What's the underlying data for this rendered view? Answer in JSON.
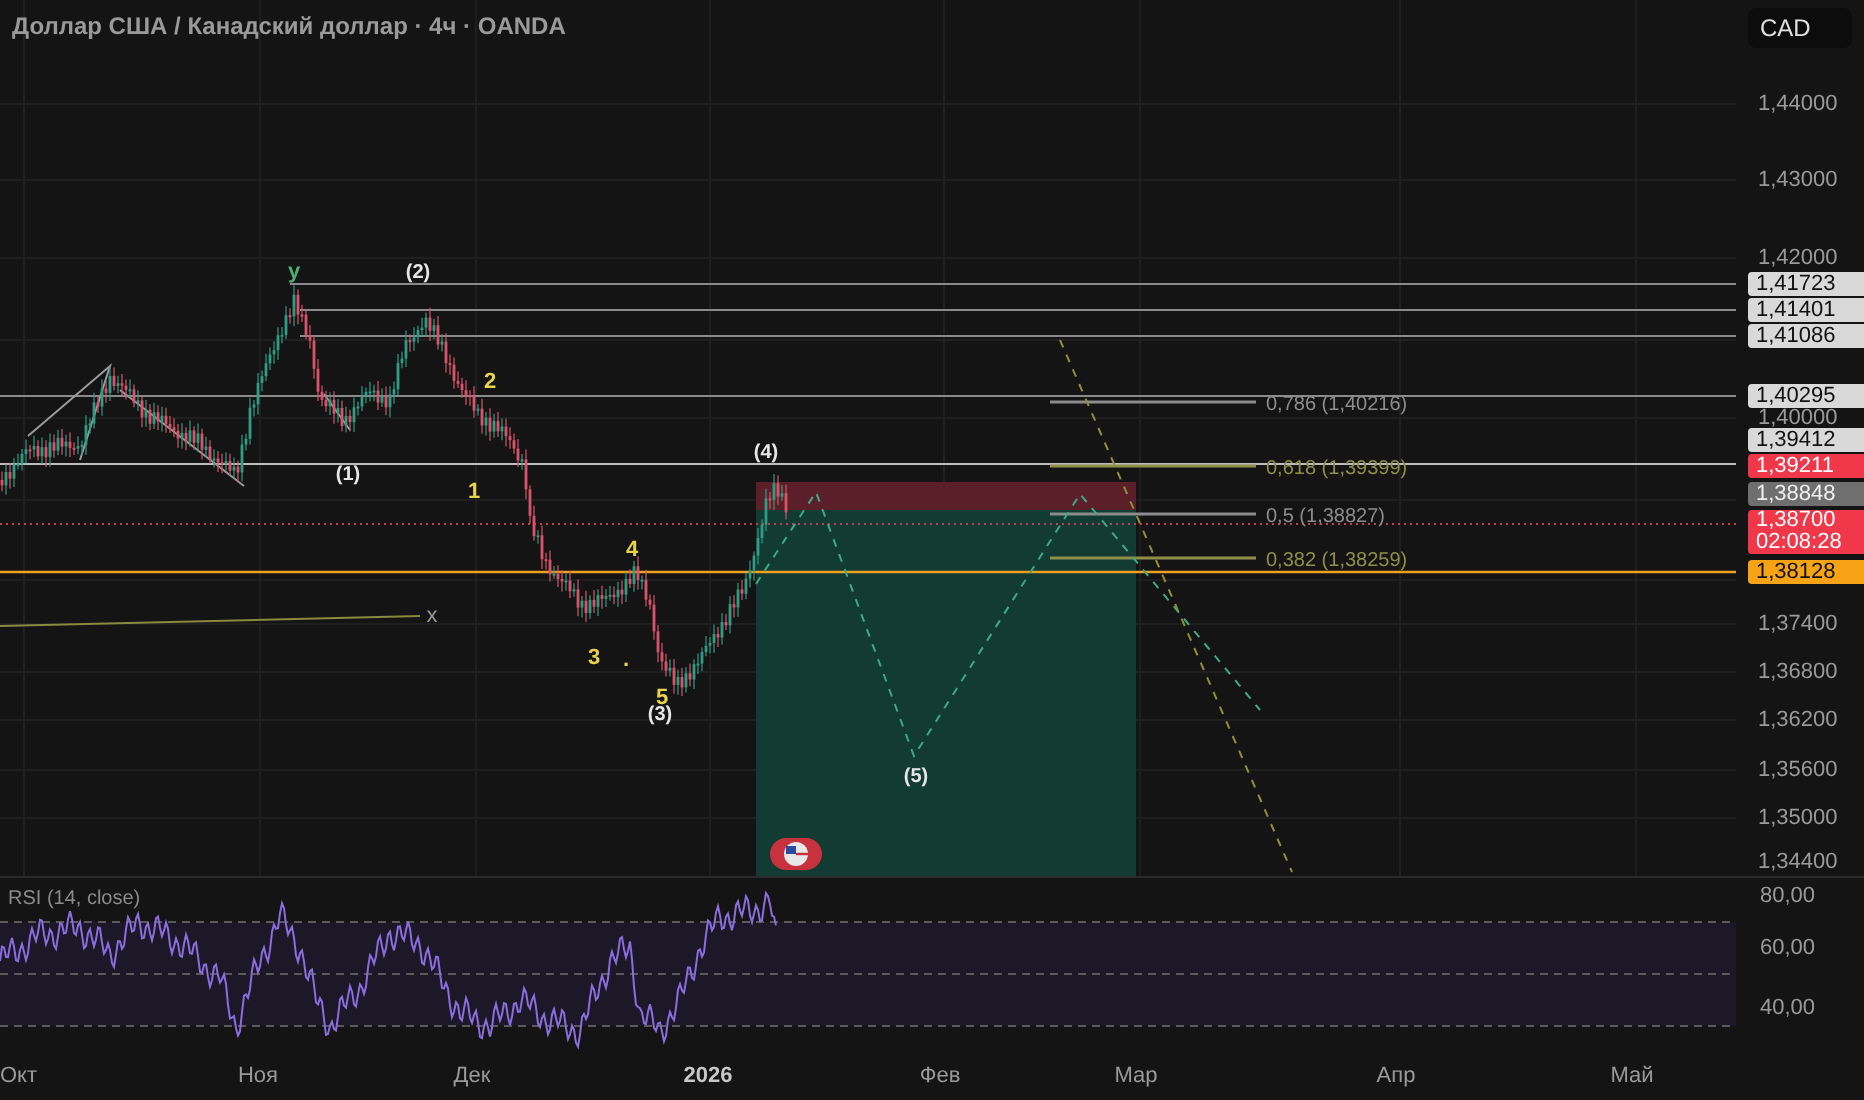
{
  "title": "Доллар США / Канадский доллар · 4ч · OANDA",
  "currency_button": "CAD",
  "price_ticks": [
    "1,44000",
    "1,43000",
    "1,42000",
    "1,40000",
    "1,37400",
    "1,36800",
    "1,36200",
    "1,35600",
    "1,35000",
    "1,34400"
  ],
  "price_labels": [
    {
      "text": "1,41723",
      "kind": "line"
    },
    {
      "text": "1,41401",
      "kind": "line"
    },
    {
      "text": "1,41086",
      "kind": "line"
    },
    {
      "text": "1,40295",
      "kind": "line"
    },
    {
      "text": "1,39412",
      "kind": "line"
    },
    {
      "text": "1,39211",
      "kind": "stop"
    },
    {
      "text": "1,38848",
      "kind": "entry"
    },
    {
      "text": "1,38700",
      "time": "02:08:28",
      "kind": "last"
    },
    {
      "text": "1,38128",
      "kind": "alert"
    }
  ],
  "fib_levels": [
    {
      "label": "0,786 (1,40216)",
      "color": "#8c8c8c"
    },
    {
      "label": "0,618 (1,39399)",
      "color": "#8f8f4a"
    },
    {
      "label": "0,5 (1,38827)",
      "color": "#8c8c8c"
    },
    {
      "label": "0,382 (1,38259)",
      "color": "#8f8f4a"
    }
  ],
  "wave_labels": [
    {
      "text": "y",
      "kind": "corrective"
    },
    {
      "text": "(2)",
      "kind": "major"
    },
    {
      "text": "2",
      "kind": "minor"
    },
    {
      "text": "(1)",
      "kind": "major"
    },
    {
      "text": "1",
      "kind": "minor"
    },
    {
      "text": "(4)",
      "kind": "major"
    },
    {
      "text": "4",
      "kind": "minor"
    },
    {
      "text": "x",
      "kind": "marker"
    },
    {
      "text": "3",
      "kind": "minor"
    },
    {
      "text": ".",
      "kind": "minor"
    },
    {
      "text": "5",
      "kind": "minor"
    },
    {
      "text": "(3)",
      "kind": "major"
    },
    {
      "text": "(5)",
      "kind": "major"
    }
  ],
  "rsi": {
    "title": "RSI (14, close)",
    "ticks": [
      "80,00",
      "60,00",
      "40,00"
    ]
  },
  "time_axis": [
    {
      "text": "Окт",
      "kind": "month"
    },
    {
      "text": "Ноя",
      "kind": "month"
    },
    {
      "text": "Дек",
      "kind": "month"
    },
    {
      "text": "2026",
      "kind": "year"
    },
    {
      "text": "Фев",
      "kind": "month"
    },
    {
      "text": "Мар",
      "kind": "month"
    },
    {
      "text": "Апр",
      "kind": "month"
    },
    {
      "text": "Май",
      "kind": "month"
    }
  ]
}
